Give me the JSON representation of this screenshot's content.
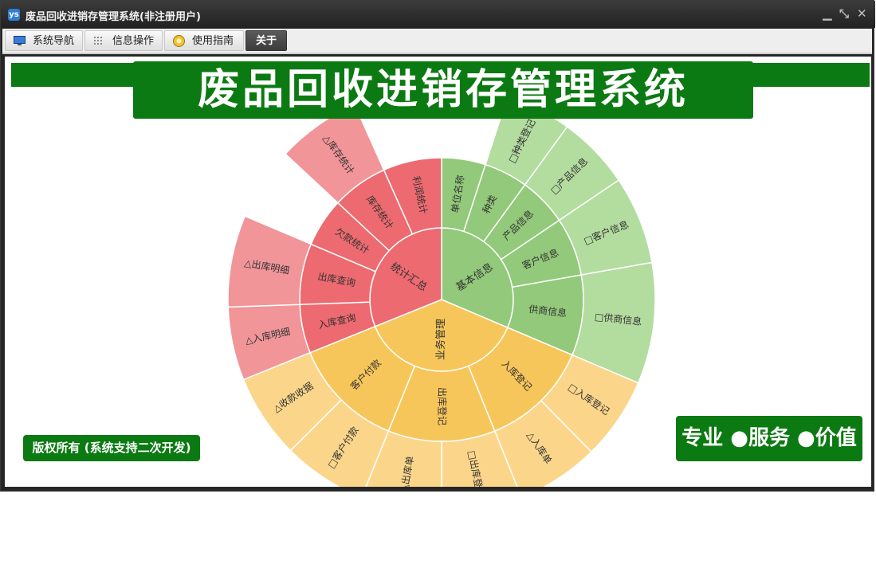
{
  "window": {
    "title": "废品回收进销存管理系统(非注册用户)",
    "app_icon": "ys",
    "minimize": "▁",
    "restore": "⤡",
    "close": "✕"
  },
  "menu": {
    "tabs": [
      {
        "label": "系统导航",
        "icon": "monitor-icon"
      },
      {
        "label": "信息操作",
        "icon": "grid-icon"
      },
      {
        "label": "使用指南",
        "icon": "guide-icon"
      },
      {
        "label": "关于",
        "icon": ""
      }
    ],
    "active_tab": "关于"
  },
  "banner": {
    "title": "废品回收进销存管理系统"
  },
  "footer": {
    "copyright": "版权所有 (系统支持二次开发)",
    "slogan": "专业 ●服务 ●价值"
  },
  "colors": {
    "brand_green": "#0c7a12",
    "sector_green": "#92c97a",
    "sector_green_light": "#b3dc9f",
    "sector_red": "#ed6a70",
    "sector_red_light": "#f19599",
    "sector_orange": "#f7c65a",
    "sector_orange_light": "#fbd68a"
  },
  "sunburst": {
    "center": [
      {
        "name": "基本信息",
        "children": [
          {
            "name": "单位名称"
          },
          {
            "name": "种类",
            "children": [
              {
                "name": "□种类登记"
              }
            ]
          },
          {
            "name": "产品信息",
            "children": [
              {
                "name": "□产品信息"
              }
            ]
          },
          {
            "name": "客户信息",
            "children": [
              {
                "name": "□客户信息"
              }
            ]
          },
          {
            "name": "供商信息",
            "children": [
              {
                "name": "□供商信息"
              }
            ]
          }
        ]
      },
      {
        "name": "业务管理",
        "children": [
          {
            "name": "入库登记",
            "children": [
              {
                "name": "□入库登记"
              },
              {
                "name": "△入库单"
              }
            ]
          },
          {
            "name": "出库登记",
            "children": [
              {
                "name": "□出库登记"
              },
              {
                "name": "△出库单"
              }
            ]
          },
          {
            "name": "客户付款",
            "children": [
              {
                "name": "□客户付款"
              },
              {
                "name": "△收款收据"
              }
            ]
          }
        ]
      },
      {
        "name": "统计汇总",
        "children": [
          {
            "name": "入库查询",
            "children": [
              {
                "name": "△入库明细"
              }
            ]
          },
          {
            "name": "出库查询",
            "children": [
              {
                "name": "△出库明细"
              }
            ]
          },
          {
            "name": "欠款统计"
          },
          {
            "name": "库存统计",
            "children": [
              {
                "name": "△库存统计"
              }
            ]
          },
          {
            "name": "利润统计"
          }
        ]
      }
    ]
  }
}
